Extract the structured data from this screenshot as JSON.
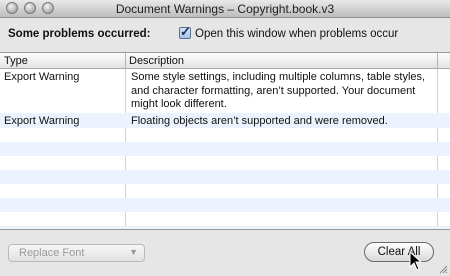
{
  "window": {
    "title": "Document Warnings – Copyright.book.v3"
  },
  "header": {
    "problems_label": "Some problems occurred:",
    "open_window_checkbox": {
      "label": "Open this window when problems occur",
      "checked": true
    }
  },
  "table": {
    "columns": [
      "Type",
      "Description"
    ],
    "rows": [
      {
        "type": "Export Warning",
        "description": "Some style settings, including multiple columns, table styles, and character formatting, aren’t supported. Your document might look different."
      },
      {
        "type": "Export Warning",
        "description": "Floating objects aren’t supported and were removed."
      }
    ]
  },
  "footer": {
    "replace_font_label": "Replace Font",
    "clear_all_label": "Clear All"
  },
  "colors": {
    "row_alt": "#edf3fe",
    "checkbox_accent": "#a8c2e6"
  }
}
